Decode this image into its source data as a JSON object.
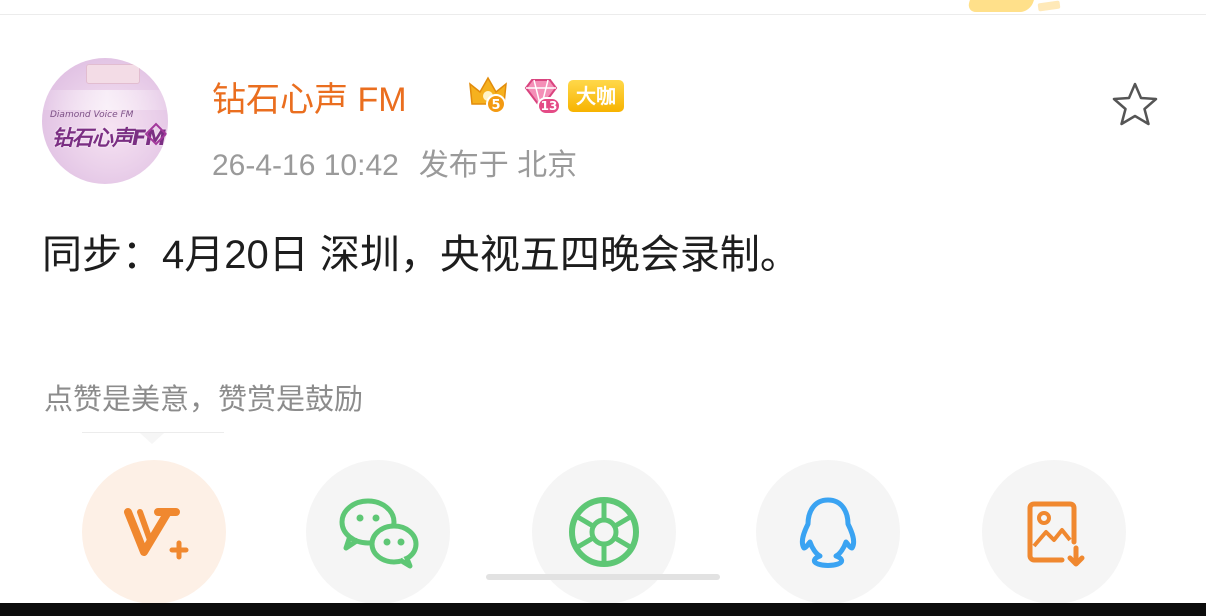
{
  "avatar": {
    "line1": "Diamond Voice FM",
    "line2": "钻石心声FM"
  },
  "user": {
    "name": "钻石心声 FM",
    "crown_level": "5",
    "gem_level": "13",
    "vip_badge": "大咖"
  },
  "meta": {
    "time": "26-4-16 10:42",
    "location": "发布于 北京"
  },
  "post": {
    "text": "同步：4月20日 深圳，央视五四晚会录制。"
  },
  "reward": {
    "text": "点赞是美意，赞赏是鼓励"
  },
  "share": {
    "icons": [
      "v-plus-icon",
      "wechat-icon",
      "moments-icon",
      "qq-icon",
      "save-image-icon"
    ]
  },
  "colors": {
    "username": "#ea6e1f",
    "vip_badge": "#f7b300",
    "orange_icon": "#f0882f",
    "wechat_green": "#5ec775",
    "qq_blue": "#3aa3f2"
  }
}
